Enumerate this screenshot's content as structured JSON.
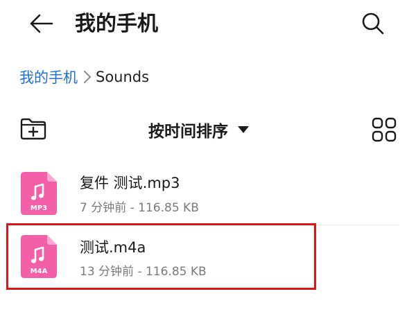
{
  "header": {
    "title": "我的手机",
    "back_icon": "arrow-left-icon",
    "search_icon": "search-icon"
  },
  "breadcrumb": {
    "root": "我的手机",
    "current": "Sounds"
  },
  "toolbar": {
    "sort_label": "按时间排序",
    "new_folder_icon": "new-folder-icon",
    "view_icon": "grid-view-icon"
  },
  "files": [
    {
      "name": "复件 测试.mp3",
      "meta": "7 分钟前 - 116.85 KB",
      "type_badge": "MP3",
      "selected": false
    },
    {
      "name": "测试.m4a",
      "meta": "13 分钟前 - 116.85 KB",
      "type_badge": "M4A",
      "selected": true
    }
  ],
  "colors": {
    "accent": "#1f6fe0",
    "file_icon": "#f460a8",
    "file_icon_fold": "#f9a9cf",
    "highlight": "#e0131b",
    "meta_text": "#7a7a7a"
  }
}
